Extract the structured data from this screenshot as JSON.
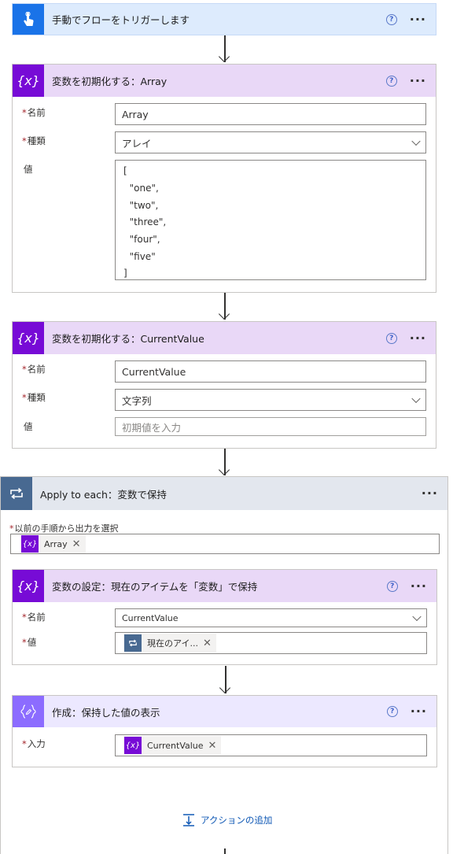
{
  "trigger": {
    "title": "手動でフローをトリガーします",
    "help_icon": "help-circle-icon",
    "more_icon": "more-ellipsis-icon"
  },
  "init_array": {
    "title": "変数を初期化する：Array",
    "name_label": "名前",
    "name_value": "Array",
    "type_label": "種類",
    "type_value": "アレイ",
    "value_label": "値",
    "value_lines": [
      "[",
      "  \"one\",",
      "  \"two\",",
      "  \"three\",",
      "  \"four\",",
      "  \"five\"",
      "]"
    ]
  },
  "init_current": {
    "title": "変数を初期化する：CurrentValue",
    "name_label": "名前",
    "name_value": "CurrentValue",
    "type_label": "種類",
    "type_value": "文字列",
    "value_label": "値",
    "value_placeholder": "初期値を入力"
  },
  "apply_each": {
    "title": "Apply to each：変数で保持",
    "select_label": "以前の手順から出力を選択",
    "token_label": "Array",
    "token_icon": "{x}",
    "add_action": "アクションの追加"
  },
  "set_var": {
    "title": "変数の設定：現在のアイテムを「変数」で保持",
    "name_label": "名前",
    "name_value": "CurrentValue",
    "value_label": "値",
    "token_label": "現在のアイ..."
  },
  "compose": {
    "title": "作成：保持した値の表示",
    "input_label": "入力",
    "token_label": "CurrentValue",
    "token_icon": "{x}"
  },
  "colors": {
    "trigger_accent": "#1a73e8",
    "trigger_header_bg": "#ddebfd",
    "variable_accent": "#770bd6",
    "variable_header_bg": "#e9d8f7",
    "loop_accent": "#486991",
    "loop_header_bg": "#e3e7ee",
    "compose_accent": "#8c6cff",
    "compose_header_bg": "#ece8ff"
  }
}
